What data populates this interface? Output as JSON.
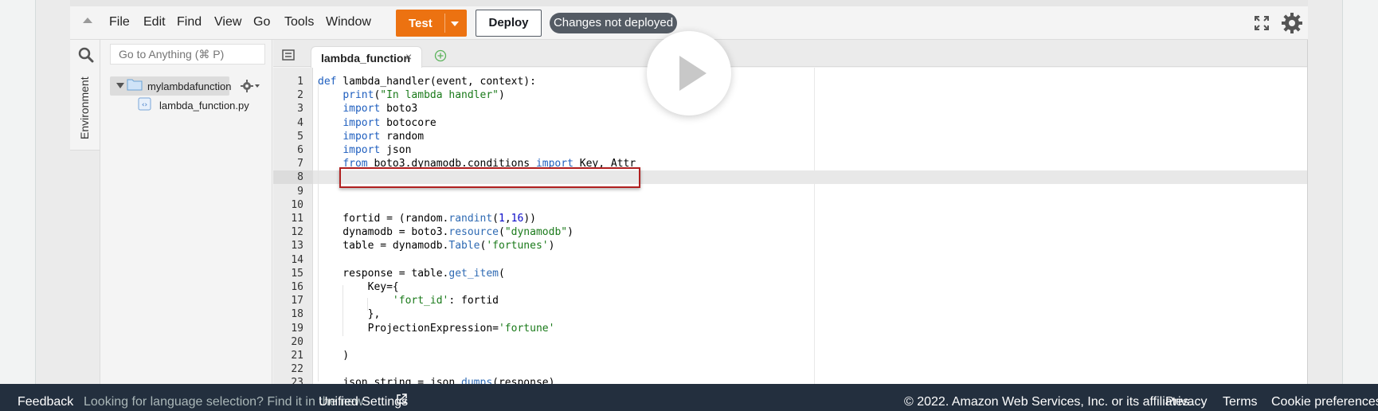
{
  "menubar": {
    "items": [
      "File",
      "Edit",
      "Find",
      "View",
      "Go",
      "Tools",
      "Window"
    ],
    "test_label": "Test",
    "deploy_label": "Deploy",
    "status_badge": "Changes not deployed"
  },
  "sidebar": {
    "tab_label": "Environment",
    "goto_placeholder": "Go to Anything (⌘ P)",
    "folder": "mylambdafunction",
    "file": "lambda_function.py"
  },
  "editor": {
    "tab_label": "lambda_function",
    "tab_close": "×",
    "line_numbers": [
      "1",
      "2",
      "3",
      "4",
      "5",
      "6",
      "7",
      "8",
      "9",
      "10",
      "11",
      "12",
      "13",
      "14",
      "15",
      "16",
      "17",
      "18",
      "19",
      "20",
      "21",
      "22",
      "23"
    ],
    "active_line": 8
  },
  "code_lines": [
    "def lambda_handler(event, context):",
    "    print(\"In lambda handler\")",
    "    import boto3",
    "    import botocore",
    "    import random",
    "    import json",
    "    from boto3.dynamodb.conditions import Key, Attr",
    "",
    "",
    "",
    "    fortid = (random.randint(1,16))",
    "    dynamodb = boto3.resource(\"dynamodb\")",
    "    table = dynamodb.Table('fortunes')",
    "",
    "    response = table.get_item(",
    "        Key={",
    "            'fort_id': fortid",
    "        },",
    "        ProjectionExpression='fortune'",
    "",
    "    )",
    "",
    "    json_string = json.dumps(response)"
  ],
  "footer": {
    "feedback": "Feedback",
    "language_prefix": "Looking for language selection? Find it in the new",
    "unified_settings": "Unified Settings",
    "copyright": "© 2022. Amazon Web Services, Inc. or its affiliates.",
    "privacy": "Privacy",
    "terms": "Terms",
    "cookies": "Cookie preferences"
  },
  "icons": {
    "collapse": "collapse-triangle-icon",
    "fullscreen": "fullscreen-icon",
    "settings": "gear-icon",
    "search": "search-icon",
    "folder": "folder-icon",
    "file": "python-file-icon",
    "add_tab": "plus-circle-icon",
    "play": "play-icon",
    "external": "external-link-icon"
  },
  "colors": {
    "test_button": "#ec7211",
    "badge": "#545b64",
    "footer": "#232f3e",
    "highlight_box": "#b02020"
  }
}
